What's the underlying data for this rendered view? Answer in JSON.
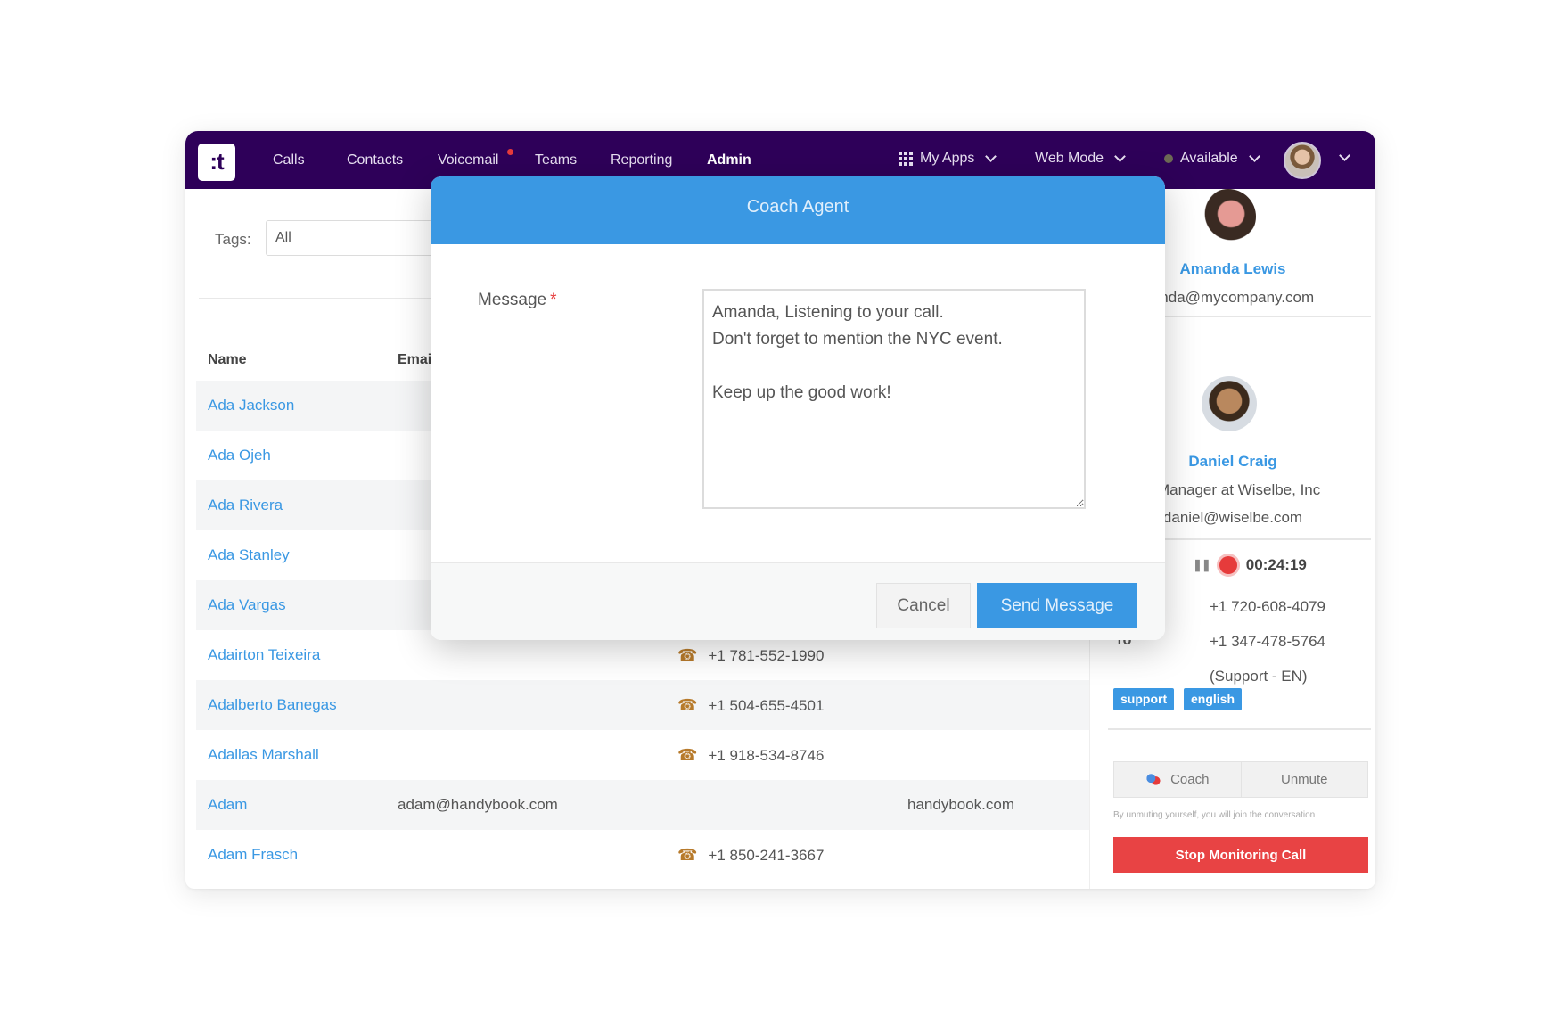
{
  "navbar": {
    "logo": ":t",
    "items": [
      {
        "label": "Calls",
        "active": false
      },
      {
        "label": "Contacts",
        "active": false
      },
      {
        "label": "Voicemail",
        "active": false,
        "notification": true
      },
      {
        "label": "Teams",
        "active": false
      },
      {
        "label": "Reporting",
        "active": false
      },
      {
        "label": "Admin",
        "active": true
      }
    ],
    "my_apps": "My Apps",
    "mode": "Web Mode",
    "status": "Available",
    "status_color": "#6d6a55"
  },
  "filters": {
    "tags_label": "Tags:",
    "tags_value": "All"
  },
  "table": {
    "columns": [
      "Name",
      "Email"
    ],
    "rows": [
      {
        "name": "Ada Jackson",
        "email": "",
        "phone": "",
        "company": ""
      },
      {
        "name": "Ada Ojeh",
        "email": "",
        "phone": "",
        "company": ""
      },
      {
        "name": "Ada Rivera",
        "email": "",
        "phone": "",
        "company": ""
      },
      {
        "name": "Ada Stanley",
        "email": "",
        "phone": "",
        "company": ""
      },
      {
        "name": "Ada Vargas",
        "email": "",
        "phone": "",
        "company": ""
      },
      {
        "name": "Adairton Teixeira",
        "email": "",
        "phone": "+1 781-552-1990",
        "company": ""
      },
      {
        "name": "Adalberto Banegas",
        "email": "",
        "phone": "+1 504-655-4501",
        "company": ""
      },
      {
        "name": "Adallas Marshall",
        "email": "",
        "phone": "+1 918-534-8746",
        "company": ""
      },
      {
        "name": "Adam",
        "email": "adam@handybook.com",
        "phone": "",
        "company": "handybook.com"
      },
      {
        "name": "Adam Frasch",
        "email": "",
        "phone": "+1 850-241-3667",
        "company": ""
      }
    ]
  },
  "call_panel": {
    "agent": {
      "name": "Amanda Lewis",
      "email": "anda@mycompany.com"
    },
    "partial_label": "t",
    "contact": {
      "name": "Daniel Craig",
      "title": "s Manager at Wiselbe, Inc",
      "email": "daniel@wiselbe.com"
    },
    "timer": "00:24:19",
    "from_number": "+1 720-608-4079",
    "to_label": "To",
    "to_number": "+1 347-478-5764",
    "queue": "(Support - EN)",
    "tags": [
      "support",
      "english"
    ],
    "coach_label": "Coach",
    "unmute_label": "Unmute",
    "hint": "By unmuting yourself, you will join the conversation",
    "stop_label": "Stop Monitoring Call"
  },
  "dialog": {
    "title": "Coach Agent",
    "message_label": "Message",
    "required_mark": "*",
    "message_value": "Amanda, Listening to your call.\nDon't forget to mention the NYC event.\n\nKeep up the good work!",
    "cancel_label": "Cancel",
    "send_label": "Send Message"
  }
}
